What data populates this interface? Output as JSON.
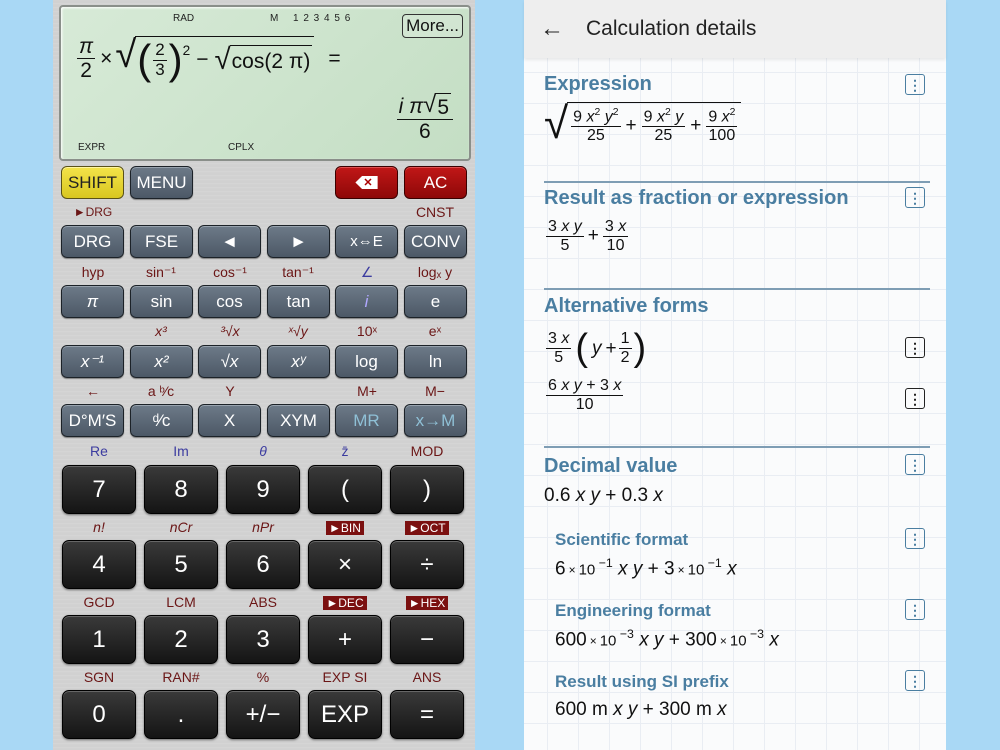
{
  "calculator": {
    "display": {
      "indicators": {
        "angle": "RAD",
        "memory": "M",
        "slots": "1 2 3 4 5 6",
        "mode": "EXPR",
        "complex": "CPLX"
      },
      "more_label": "More...",
      "input": {
        "pi": "π",
        "two": "2",
        "times": "×",
        "frac_num": "2",
        "frac_den": "3",
        "exp": "2",
        "minus": "−",
        "cos_arg": "cos(2 π)",
        "equals": "="
      },
      "result": {
        "numerator_prefix": "i π",
        "radicand": "5",
        "denominator": "6"
      }
    },
    "rows": [
      {
        "keys": [
          "SHIFT",
          "MENU",
          "⌫",
          "AC"
        ]
      },
      {
        "shift_labels": [
          "►DRG",
          "",
          "",
          "",
          "",
          "CNST"
        ],
        "keys": [
          "DRG",
          "FSE",
          "◄",
          "►",
          "x⇔E",
          "CONV"
        ]
      },
      {
        "shift_labels": [
          "hyp",
          "sin⁻¹",
          "cos⁻¹",
          "tan⁻¹",
          "∠",
          "logₓ y"
        ],
        "keys": [
          "π",
          "sin",
          "cos",
          "tan",
          "i",
          "e"
        ]
      },
      {
        "shift_labels": [
          "",
          "x³",
          "³√x",
          "ˣ√y",
          "10ˣ",
          "eˣ"
        ],
        "keys": [
          "x⁻¹",
          "x²",
          "√x",
          "xʸ",
          "log",
          "ln"
        ]
      },
      {
        "shift_labels": [
          "←",
          "a ᵇ⁄c",
          "Y",
          "",
          "M+",
          "M−"
        ],
        "keys": [
          "D°M′S",
          "ᵈ⁄c",
          "X",
          "XYM",
          "MR",
          "x→M"
        ]
      },
      {
        "shift_labels": [
          "Re",
          "Im",
          "θ",
          "z̄",
          "MOD"
        ],
        "keys": [
          "7",
          "8",
          "9",
          "(",
          ")"
        ]
      },
      {
        "shift_labels": [
          "n!",
          "nCr",
          "nPr",
          "►BIN",
          "►OCT"
        ],
        "keys": [
          "4",
          "5",
          "6",
          "×",
          "÷"
        ]
      },
      {
        "shift_labels": [
          "GCD",
          "LCM",
          "ABS",
          "►DEC",
          "►HEX"
        ],
        "keys": [
          "1",
          "2",
          "3",
          "+",
          "−"
        ]
      },
      {
        "shift_labels": [
          "SGN",
          "RAN#",
          "%",
          "EXP SI",
          "ANS"
        ],
        "keys": [
          "0",
          ".",
          "+/−",
          "EXP",
          "="
        ]
      }
    ],
    "colors": {
      "shift": "#e8d63a",
      "clear": "#a90f0f",
      "function_key": "#5b6775",
      "digit_key": "#222222",
      "shift_label": "#6b1616",
      "complex_label": "#3c3ca0"
    }
  },
  "details": {
    "back_icon": "←",
    "title": "Calculation details",
    "sections": [
      {
        "title": "Expression",
        "value": "√(9x²y²/25 + 9x²y/25 + 9x²/100)"
      },
      {
        "title": "Result as fraction or expression",
        "value": "3xy/5 + 3x/10"
      },
      {
        "title": "Alternative forms",
        "items": [
          "3x/5 (y + 1/2)",
          "(6xy + 3x)/10"
        ]
      },
      {
        "title": "Decimal value",
        "value": "0.6 x y + 0.3 x"
      },
      {
        "title": "Scientific format",
        "value": "6×10⁻¹ x y + 3×10⁻¹ x"
      },
      {
        "title": "Engineering format",
        "value": "600×10⁻³ x y + 300×10⁻³ x"
      },
      {
        "title": "Result using SI prefix",
        "value": "600 m x y + 300 m x"
      }
    ],
    "colors": {
      "section_title": "#4a7ea1",
      "divider": "#7e9db4",
      "topbar": "#eeeeee"
    }
  }
}
